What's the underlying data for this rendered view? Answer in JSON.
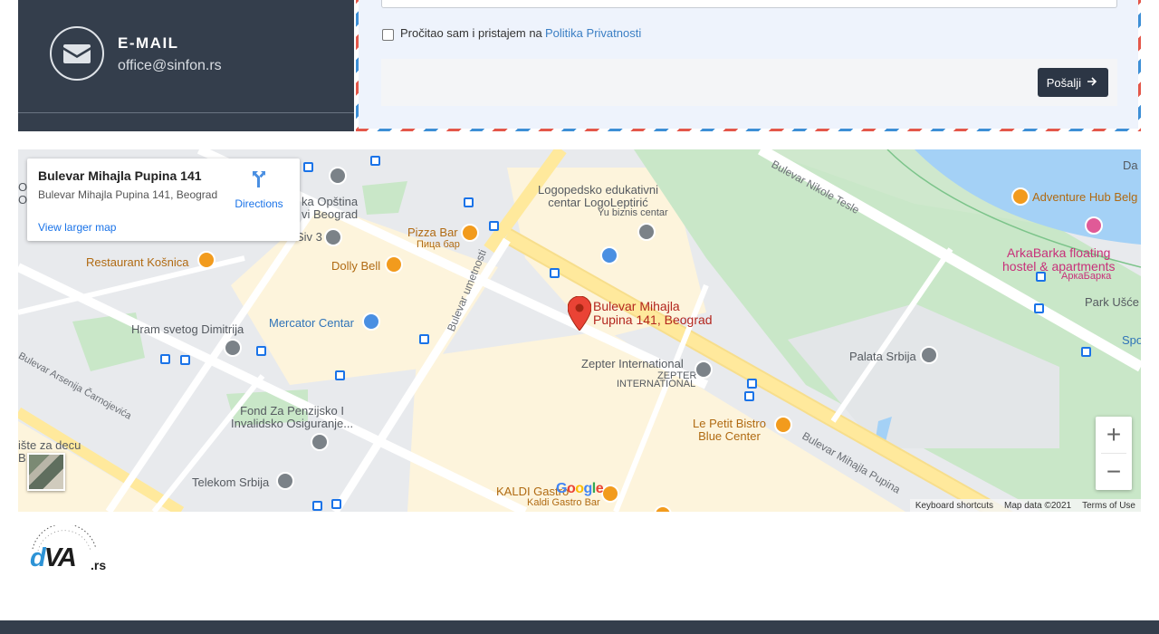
{
  "contact": {
    "email_title": "E-MAIL",
    "email_value": "office@sinfon.rs",
    "icon": "envelope-icon"
  },
  "form": {
    "consent_text": "Pročitao sam i pristajem na",
    "consent_link": "Politika Privatnosti",
    "consent_checked": false,
    "submit_label": "Pošalji",
    "submit_icon": "arrow-right-icon",
    "accent_colors": {
      "airmail_red": "#e4574a",
      "airmail_blue": "#3d8fd6",
      "button": "#2c3645"
    }
  },
  "map": {
    "info_card": {
      "title": "Bulevar Mihajla Pupina 141",
      "address": "Bulevar Mihajla Pupina 141, Beograd",
      "directions_label": "Directions",
      "larger_map_label": "View larger map"
    },
    "marker_label_line1": "Bulevar Mihajla",
    "marker_label_line2": "Pupina 141, Beograd",
    "places": {
      "logopedski_1": "Logopedsko edukativni",
      "logopedski_2": "centar LogoLeptirić",
      "yu_biznis": "Yu biznis centar",
      "pizza_bar": "Pizza Bar",
      "pizza_bar_cyr": "Пица бар",
      "opstina_1": "ka Opština",
      "opstina_2": "vi Beograd",
      "siv3": "Siv 3",
      "dolly_bell": "Dolly Bell",
      "restaurant_kosnica": "Restaurant Košnica",
      "mercator": "Mercator Centar",
      "hram": "Hram svetog Dimitrija",
      "fond_1": "Fond Za Penzijsko I",
      "fond_2": "Invalidsko Osiguranje...",
      "telekom": "Telekom Srbija",
      "zepter_1": "Zepter International",
      "zepter_2": "ZEPTER",
      "zepter_3": "INTERNATIONAL",
      "le_petit_1": "Le Petit Bistro",
      "le_petit_2": "Blue Center",
      "kaldi_1": "KALDI Gastro",
      "kaldi_2": "Kaldi Gastro Bar",
      "adventure_hub": "Adventure Hub Belg",
      "arkabarka_1": "ArkaBarka floating",
      "arkabarka_2": "hostel & apartments",
      "arkabarka_cyr": "АркаБарка",
      "park_usce": "Park Ušće",
      "palata_srbija": "Palata Srbija",
      "sp": "Spo",
      "da": "Da",
      "ou_1": "O",
      "ou_2": "Ou",
      "liste_za": "ište za decu",
      "b_letter": "B"
    },
    "roads": {
      "nikole_tesle": "Bulevar Nikole Tesle",
      "umetnosti": "Bulevar umetnosti",
      "arsenija": "Bulevar Arsenija Čarnojevića",
      "pupina": "Bulevar Mihajla Pupina"
    },
    "zoom_in": "+",
    "zoom_out": "−",
    "google_logo": "Google",
    "footer": {
      "shortcuts": "Keyboard shortcuts",
      "map_data": "Map data ©2021",
      "terms": "Terms of Use"
    }
  },
  "logo": {
    "d": "d",
    "va": "VA",
    "rs": ".rs"
  }
}
